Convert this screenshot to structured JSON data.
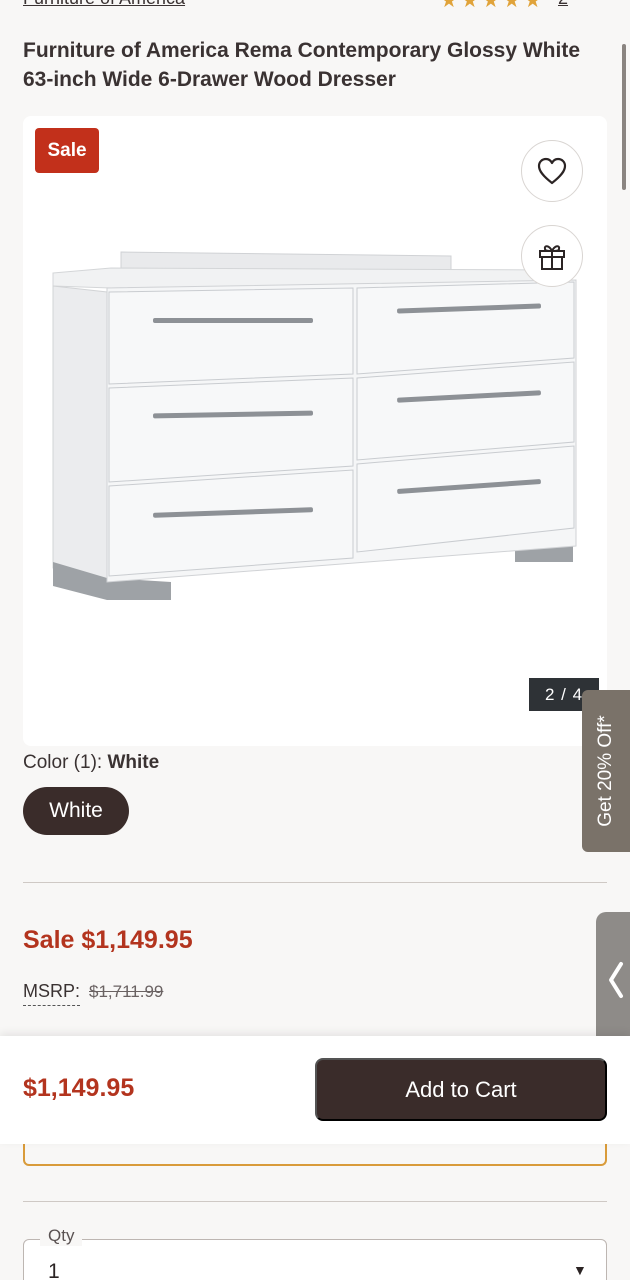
{
  "header": {
    "brand": "Furniture of America",
    "rating_stars": "★★★★★",
    "review_count": "2"
  },
  "product": {
    "title": "Furniture of America Rema Contemporary Glossy White 63-inch Wide 6-Drawer Wood Dresser"
  },
  "gallery": {
    "sale_badge": "Sale",
    "counter": "2 / 4"
  },
  "promo": {
    "tab": "Get 20% Off*"
  },
  "color": {
    "label_prefix": "Color (1): ",
    "selected": "White",
    "swatch": "White"
  },
  "pricing": {
    "sale_price": "Sale $1,149.95",
    "msrp_label": "MSRP:",
    "msrp_value": "$1,711.99"
  },
  "sticky": {
    "price": "$1,149.95",
    "add_to_cart": "Add to Cart"
  },
  "qty": {
    "label": "Qty",
    "value": "1"
  },
  "icons": {
    "heart": "heart-icon",
    "gift": "gift-icon",
    "chevron": "chevron-left-icon",
    "caret": "caret-down-icon"
  },
  "colors": {
    "sale_red": "#b3341e",
    "dark_brown": "#3a2c2a",
    "promo_gray": "#7a7269"
  }
}
